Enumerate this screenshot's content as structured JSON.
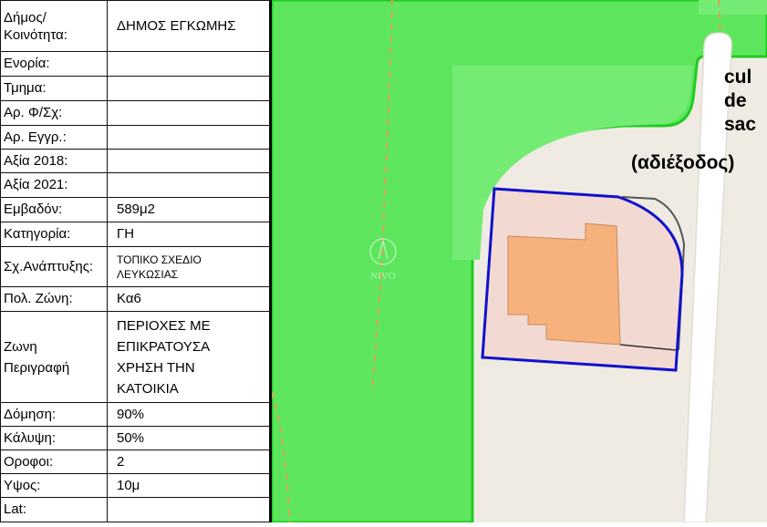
{
  "info_table": {
    "rows": [
      {
        "key": "Δήμος/\nΚοινότητα:",
        "value": "ΔΗΜΟΣ ΕΓΚΩΜΗΣ"
      },
      {
        "key": "Ενορία:",
        "value": ""
      },
      {
        "key": "Τμημα:",
        "value": ""
      },
      {
        "key": "Αρ. Φ/Σχ:",
        "value": ""
      },
      {
        "key": "Αρ. Εγγρ.:",
        "value": ""
      },
      {
        "key": "Αξία 2018:",
        "value": ""
      },
      {
        "key": "Αξία 2021:",
        "value": ""
      },
      {
        "key": "Εμβαδόν:",
        "value": "589μ2"
      },
      {
        "key": "Κατηγορία:",
        "value": "ΓΗ"
      },
      {
        "key": "Σχ.Ανάπτυξης:",
        "value": "ΤΟΠΙΚΟ ΣΧΕΔΙΟ\nΛΕΥΚΩΣΙΑΣ"
      },
      {
        "key": "Πολ. Ζώνη:",
        "value": "Κα6"
      },
      {
        "key": "Ζωνη\nΠεριγραφή",
        "value": "ΠΕΡΙΟΧΕΣ ΜΕ\nΕΠΙΚΡΑΤΟΥΣΑ\nΧΡΗΣΗ ΤΗΝ\nΚΑΤΟΙΚΙΑ"
      },
      {
        "key": "Δόμηση:",
        "value": "90%"
      },
      {
        "key": "Κάλυψη:",
        "value": "50%"
      },
      {
        "key": "Οροφοι:",
        "value": "2"
      },
      {
        "key": "Υψος:",
        "value": "10μ"
      },
      {
        "key": "Lat:",
        "value": ""
      }
    ]
  },
  "map": {
    "road_label_lines": [
      "cul",
      "de",
      "sac"
    ],
    "road_label_translation": "(αδιέξοδος)",
    "watermark_text": "NIVO",
    "colors": {
      "green_area": "#5de65d",
      "light_green": "#74ec74",
      "green_border": "#1fcc1f",
      "road_bg": "#efebe3",
      "road": "#ffffff",
      "parcel_fill": "#f2d9d2",
      "parcel_border": "#1111cc",
      "building_fill": "#f7b27c",
      "building_border": "#c48a5e",
      "trail": "#d9a15a"
    }
  }
}
